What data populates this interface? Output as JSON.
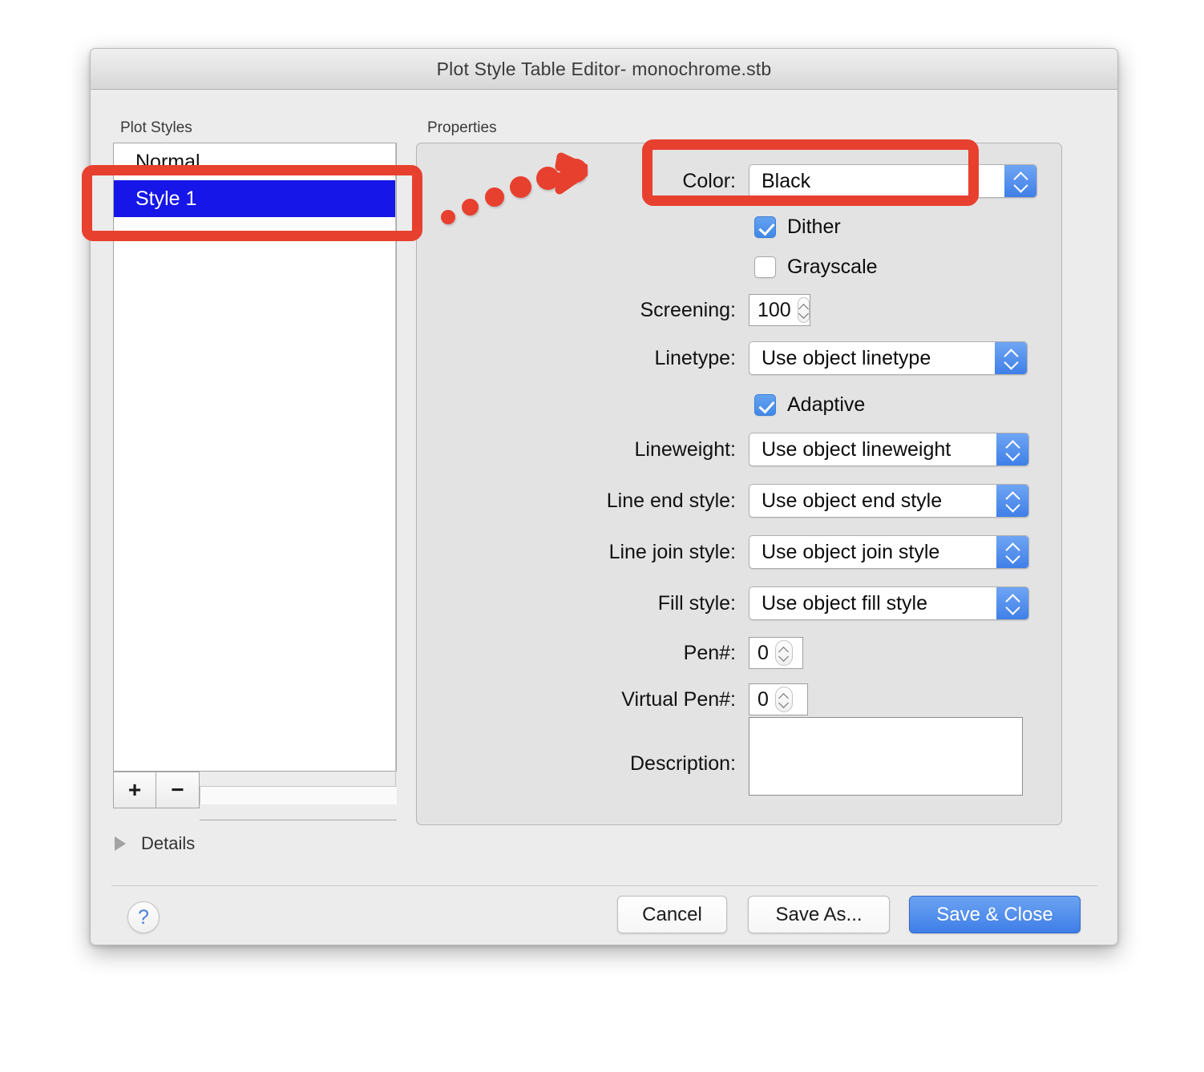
{
  "window": {
    "title": "Plot Style Table Editor- monochrome.stb"
  },
  "plot_styles": {
    "group_label": "Plot Styles",
    "items": [
      {
        "label": "Normal",
        "selected": false
      },
      {
        "label": "Style 1",
        "selected": true
      }
    ],
    "add_button": "+",
    "remove_button": "−"
  },
  "properties": {
    "group_label": "Properties",
    "color": {
      "label": "Color:",
      "value": "Black"
    },
    "dither": {
      "label": "Dither",
      "checked": true
    },
    "grayscale": {
      "label": "Grayscale",
      "checked": false
    },
    "screening": {
      "label": "Screening:",
      "value": "100"
    },
    "linetype": {
      "label": "Linetype:",
      "value": "Use object linetype"
    },
    "adaptive": {
      "label": "Adaptive",
      "checked": true
    },
    "lineweight": {
      "label": "Lineweight:",
      "value": "Use object lineweight"
    },
    "line_end_style": {
      "label": "Line end style:",
      "value": "Use object end style"
    },
    "line_join_style": {
      "label": "Line join style:",
      "value": "Use object join style"
    },
    "fill_style": {
      "label": "Fill style:",
      "value": "Use object fill style"
    },
    "pen_number": {
      "label": "Pen#:",
      "value": "0"
    },
    "virtual_pen_number": {
      "label": "Virtual Pen#:",
      "value": "0"
    },
    "description": {
      "label": "Description:",
      "value": ""
    }
  },
  "details": {
    "label": "Details"
  },
  "footer": {
    "help_label": "?",
    "cancel_label": "Cancel",
    "save_as_label": "Save As...",
    "save_close_label": "Save & Close"
  },
  "annotations": {
    "highlight_color": "#e7402f",
    "selection_color": "#1616e8",
    "accent_color": "#3f7ee7"
  }
}
